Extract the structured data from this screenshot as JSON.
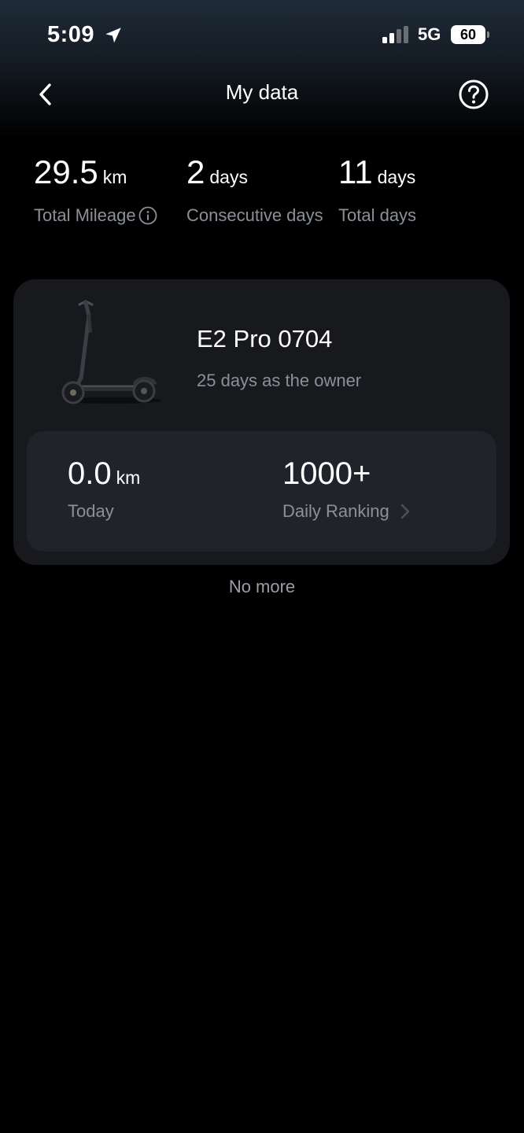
{
  "status_bar": {
    "time": "5:09",
    "network": "5G",
    "battery": "60"
  },
  "nav": {
    "title": "My data"
  },
  "stats": {
    "mileage": {
      "value": "29.5",
      "unit": "km",
      "label": "Total Mileage"
    },
    "consecutive": {
      "value": "2",
      "unit": "days",
      "label": "Consecutive days"
    },
    "total_days": {
      "value": "11",
      "unit": "days",
      "label": "Total days"
    }
  },
  "vehicle": {
    "name": "E2 Pro 0704",
    "owner_text": "25 days as the owner",
    "today": {
      "value": "0.0",
      "unit": "km",
      "label": "Today"
    },
    "ranking": {
      "value": "1000+",
      "label": "Daily Ranking"
    }
  },
  "footer": {
    "no_more": "No more"
  },
  "colors": {
    "background": "#000000",
    "card": "#17191d",
    "panel": "#20242a",
    "secondary_text": "#8b9098"
  },
  "icons": {
    "back": "chevron-left-icon",
    "help": "question-circle-icon",
    "info": "info-circle-icon",
    "location": "location-arrow-icon",
    "ranking_arrow": "chevron-right-icon"
  }
}
